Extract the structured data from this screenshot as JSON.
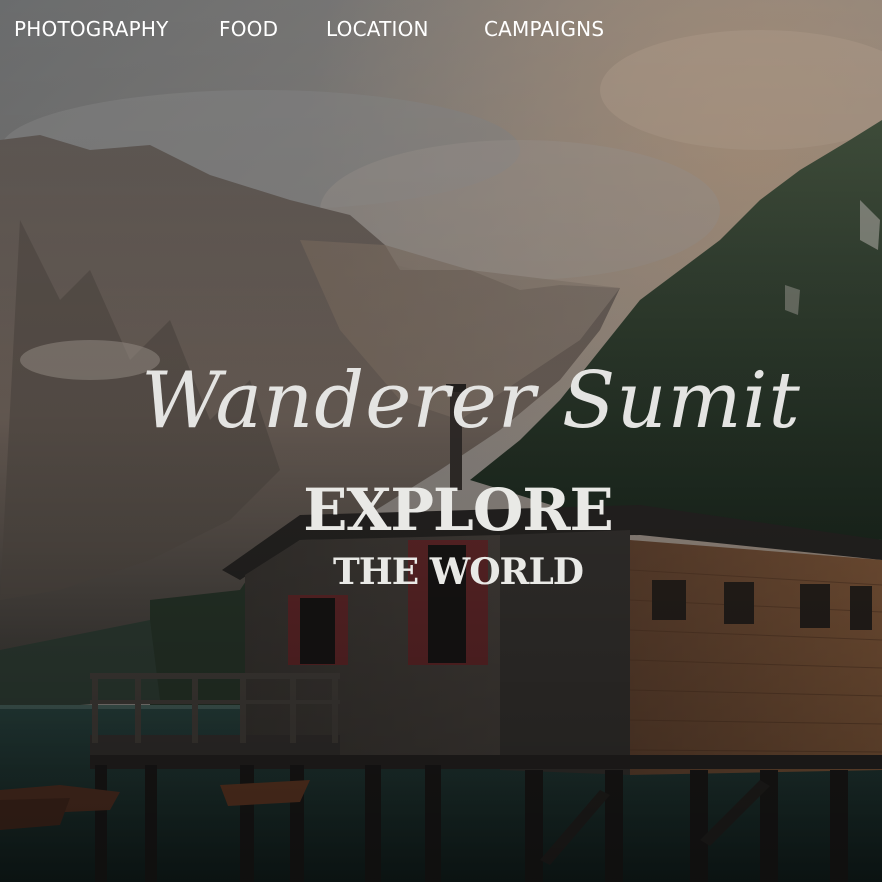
{
  "nav": {
    "items": [
      {
        "label": "PHOTOGRAPHY"
      },
      {
        "label": "FOOD"
      },
      {
        "label": "LOCATION"
      },
      {
        "label": "CAMPAIGNS"
      }
    ]
  },
  "hero": {
    "script_title": "Wanderer Sumit",
    "headline": "EXPLORE",
    "subheadline": "THE WORLD"
  },
  "colors": {
    "nav_text": "#ffffff",
    "heading_text": "#e9e9e6"
  }
}
